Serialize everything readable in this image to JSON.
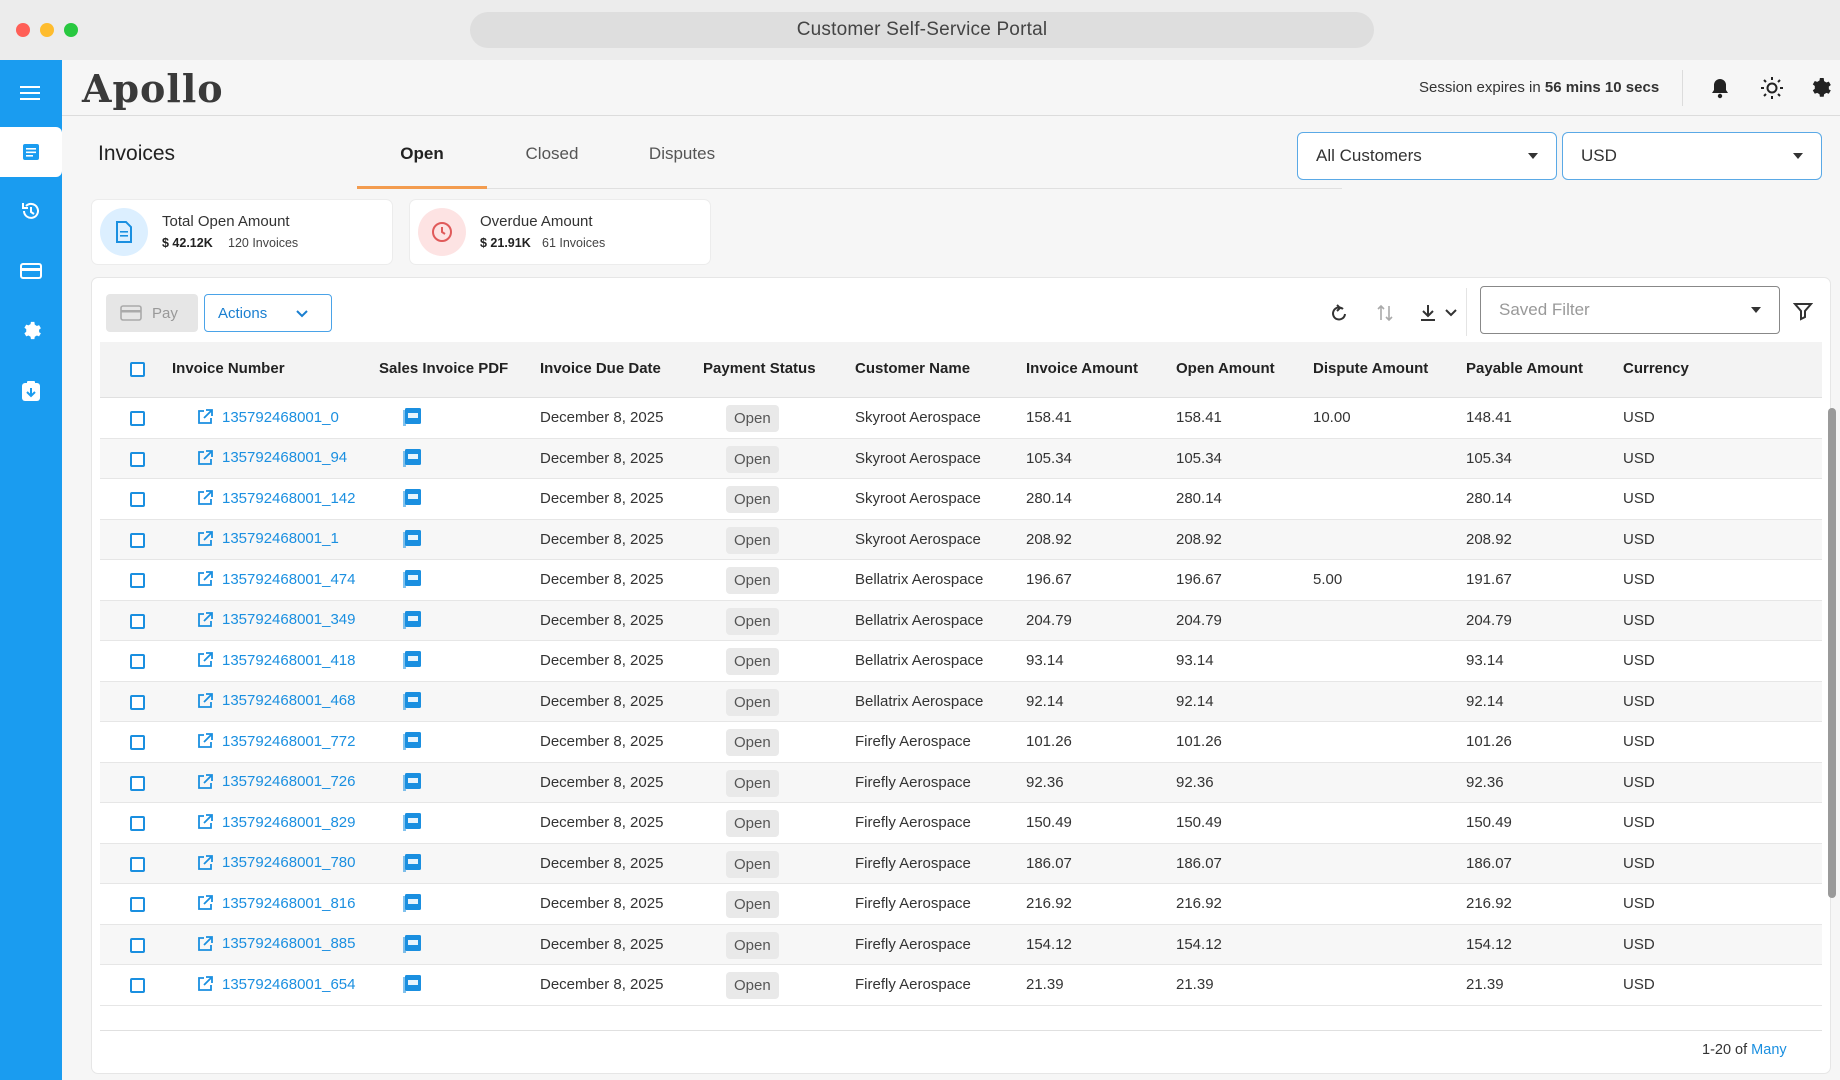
{
  "window": {
    "title": "Customer Self-Service Portal"
  },
  "sidebar": {
    "items": [
      {
        "icon": "menu-icon"
      },
      {
        "icon": "invoice-doc-icon",
        "active": true
      },
      {
        "icon": "history-icon"
      },
      {
        "icon": "card-icon"
      },
      {
        "icon": "gear-icon"
      },
      {
        "icon": "download-box-icon"
      }
    ]
  },
  "header": {
    "logo": "Apollo",
    "session_prefix": "Session expires in ",
    "session_time": "56 mins 10 secs",
    "icons": [
      "bell-icon",
      "sun-icon",
      "gear-icon"
    ]
  },
  "page": {
    "title": "Invoices",
    "tabs": [
      {
        "label": "Open",
        "active": true
      },
      {
        "label": "Closed"
      },
      {
        "label": "Disputes"
      }
    ],
    "customer_select": "All Customers",
    "currency_select": "USD"
  },
  "summary": {
    "total_open": {
      "label": "Total Open Amount",
      "amount": "$ 42.12K",
      "count": "120 Invoices"
    },
    "overdue": {
      "label": "Overdue Amount",
      "amount": "$ 21.91K",
      "count": "61 Invoices"
    }
  },
  "toolbar": {
    "pay_label": "Pay",
    "actions_label": "Actions",
    "saved_filter_placeholder": "Saved Filter"
  },
  "table": {
    "columns": [
      "Invoice Number",
      "Sales Invoice PDF",
      "Invoice Due Date",
      "Payment Status",
      "Customer Name",
      "Invoice Amount",
      "Open Amount",
      "Dispute Amount",
      "Payable Amount",
      "Currency"
    ],
    "rows": [
      {
        "invoice": "135792468001_0",
        "due": "December 8, 2025",
        "status": "Open",
        "customer": "Skyroot Aerospace",
        "amount": "158.41",
        "open": "158.41",
        "dispute": "10.00",
        "payable": "148.41",
        "currency": "USD"
      },
      {
        "invoice": "135792468001_94",
        "due": "December 8, 2025",
        "status": "Open",
        "customer": "Skyroot Aerospace",
        "amount": "105.34",
        "open": "105.34",
        "dispute": "",
        "payable": "105.34",
        "currency": "USD"
      },
      {
        "invoice": "135792468001_142",
        "due": "December 8, 2025",
        "status": "Open",
        "customer": "Skyroot Aerospace",
        "amount": "280.14",
        "open": "280.14",
        "dispute": "",
        "payable": "280.14",
        "currency": "USD"
      },
      {
        "invoice": "135792468001_1",
        "due": "December 8, 2025",
        "status": "Open",
        "customer": "Skyroot Aerospace",
        "amount": "208.92",
        "open": "208.92",
        "dispute": "",
        "payable": "208.92",
        "currency": "USD"
      },
      {
        "invoice": "135792468001_474",
        "due": "December 8, 2025",
        "status": "Open",
        "customer": "Bellatrix Aerospace",
        "amount": "196.67",
        "open": "196.67",
        "dispute": "5.00",
        "payable": "191.67",
        "currency": "USD"
      },
      {
        "invoice": "135792468001_349",
        "due": "December 8, 2025",
        "status": "Open",
        "customer": "Bellatrix Aerospace",
        "amount": "204.79",
        "open": "204.79",
        "dispute": "",
        "payable": "204.79",
        "currency": "USD"
      },
      {
        "invoice": "135792468001_418",
        "due": "December 8, 2025",
        "status": "Open",
        "customer": "Bellatrix Aerospace",
        "amount": "93.14",
        "open": "93.14",
        "dispute": "",
        "payable": "93.14",
        "currency": "USD"
      },
      {
        "invoice": "135792468001_468",
        "due": "December 8, 2025",
        "status": "Open",
        "customer": "Bellatrix Aerospace",
        "amount": "92.14",
        "open": "92.14",
        "dispute": "",
        "payable": "92.14",
        "currency": "USD"
      },
      {
        "invoice": "135792468001_772",
        "due": "December 8, 2025",
        "status": "Open",
        "customer": "Firefly Aerospace",
        "amount": "101.26",
        "open": "101.26",
        "dispute": "",
        "payable": "101.26",
        "currency": "USD"
      },
      {
        "invoice": "135792468001_726",
        "due": "December 8, 2025",
        "status": "Open",
        "customer": "Firefly Aerospace",
        "amount": "92.36",
        "open": "92.36",
        "dispute": "",
        "payable": "92.36",
        "currency": "USD"
      },
      {
        "invoice": "135792468001_829",
        "due": "December 8, 2025",
        "status": "Open",
        "customer": "Firefly Aerospace",
        "amount": "150.49",
        "open": "150.49",
        "dispute": "",
        "payable": "150.49",
        "currency": "USD"
      },
      {
        "invoice": "135792468001_780",
        "due": "December 8, 2025",
        "status": "Open",
        "customer": "Firefly Aerospace",
        "amount": "186.07",
        "open": "186.07",
        "dispute": "",
        "payable": "186.07",
        "currency": "USD"
      },
      {
        "invoice": "135792468001_816",
        "due": "December 8, 2025",
        "status": "Open",
        "customer": "Firefly Aerospace",
        "amount": "216.92",
        "open": "216.92",
        "dispute": "",
        "payable": "216.92",
        "currency": "USD"
      },
      {
        "invoice": "135792468001_885",
        "due": "December 8, 2025",
        "status": "Open",
        "customer": "Firefly Aerospace",
        "amount": "154.12",
        "open": "154.12",
        "dispute": "",
        "payable": "154.12",
        "currency": "USD"
      },
      {
        "invoice": "135792468001_654",
        "due": "December 8, 2025",
        "status": "Open",
        "customer": "Firefly Aerospace",
        "amount": "21.39",
        "open": "21.39",
        "dispute": "",
        "payable": "21.39",
        "currency": "USD"
      }
    ]
  },
  "pagination": {
    "range": "1-20 of ",
    "total": "Many"
  },
  "colors": {
    "accent": "#1a9cf0",
    "tab_underline": "#f39c4f",
    "link": "#1a8fe0",
    "overdue_icon": "#e05a5a"
  }
}
